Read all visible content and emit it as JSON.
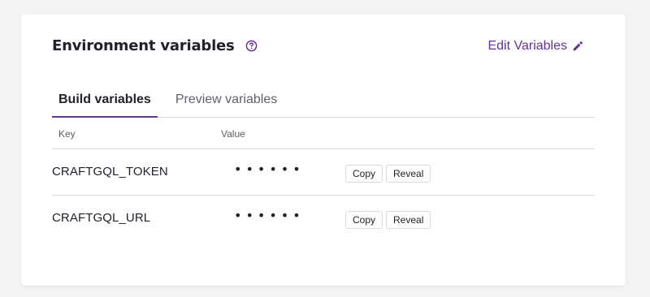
{
  "section": {
    "title": "Environment variables",
    "help_icon": "question-circle-icon",
    "edit_label": "Edit Variables",
    "edit_icon": "pencil-icon"
  },
  "tabs": [
    {
      "label": "Build variables",
      "active": true
    },
    {
      "label": "Preview variables",
      "active": false
    }
  ],
  "table": {
    "headers": {
      "key": "Key",
      "value": "Value"
    },
    "rows": [
      {
        "key": "CRAFTGQL_TOKEN",
        "value": "••••••",
        "copy_label": "Copy",
        "reveal_label": "Reveal"
      },
      {
        "key": "CRAFTGQL_URL",
        "value": "••••••",
        "copy_label": "Copy",
        "reveal_label": "Reveal"
      }
    ]
  },
  "colors": {
    "accent": "#663399",
    "text": "#232129",
    "muted": "#635e69",
    "border": "#d9d7e0",
    "background": "#f3f3f4"
  }
}
